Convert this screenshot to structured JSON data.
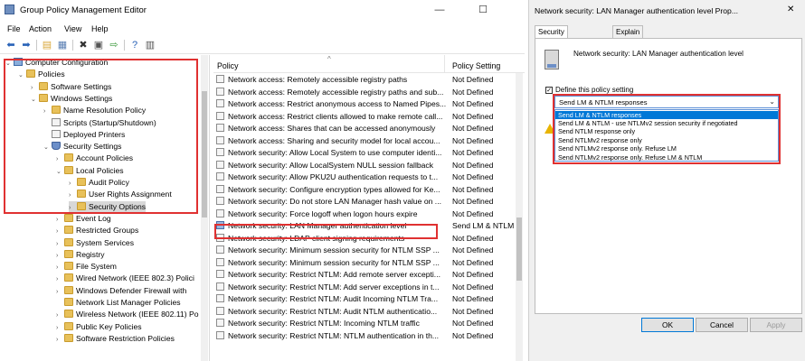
{
  "main_window": {
    "title": "Group Policy Management Editor",
    "controls": {
      "minimize": "—",
      "maximize": "☐"
    },
    "menu": [
      "File",
      "Action",
      "View",
      "Help"
    ]
  },
  "tree": {
    "items": [
      {
        "label": "Computer Configuration",
        "depth": 0,
        "expanded": true,
        "icon": "computer-icon"
      },
      {
        "label": "Policies",
        "depth": 1,
        "expanded": true,
        "icon": "folder-icon"
      },
      {
        "label": "Software Settings",
        "depth": 2,
        "expanded": false,
        "icon": "folder-icon"
      },
      {
        "label": "Windows Settings",
        "depth": 2,
        "expanded": true,
        "icon": "folder-icon"
      },
      {
        "label": "Name Resolution Policy",
        "depth": 3,
        "expanded": false,
        "icon": "folder-icon"
      },
      {
        "label": "Scripts (Startup/Shutdown)",
        "depth": 3,
        "expanded": null,
        "icon": "script-icon"
      },
      {
        "label": "Deployed Printers",
        "depth": 3,
        "expanded": null,
        "icon": "printer-icon"
      },
      {
        "label": "Security Settings",
        "depth": 3,
        "expanded": true,
        "icon": "shield-icon"
      },
      {
        "label": "Account Policies",
        "depth": 4,
        "expanded": false,
        "icon": "folder-icon"
      },
      {
        "label": "Local Policies",
        "depth": 4,
        "expanded": true,
        "icon": "folder-icon"
      },
      {
        "label": "Audit Policy",
        "depth": 5,
        "expanded": false,
        "icon": "folder-icon"
      },
      {
        "label": "User Rights Assignment",
        "depth": 5,
        "expanded": false,
        "icon": "folder-icon"
      },
      {
        "label": "Security Options",
        "depth": 5,
        "expanded": false,
        "icon": "folder-icon",
        "selected": true
      },
      {
        "label": "Event Log",
        "depth": 4,
        "expanded": false,
        "icon": "folder-icon"
      },
      {
        "label": "Restricted Groups",
        "depth": 4,
        "expanded": false,
        "icon": "folder-icon"
      },
      {
        "label": "System Services",
        "depth": 4,
        "expanded": false,
        "icon": "folder-icon"
      },
      {
        "label": "Registry",
        "depth": 4,
        "expanded": false,
        "icon": "folder-icon"
      },
      {
        "label": "File System",
        "depth": 4,
        "expanded": false,
        "icon": "folder-icon"
      },
      {
        "label": "Wired Network (IEEE 802.3) Polici",
        "depth": 4,
        "expanded": false,
        "icon": "folder-icon"
      },
      {
        "label": "Windows Defender Firewall with",
        "depth": 4,
        "expanded": false,
        "icon": "folder-icon"
      },
      {
        "label": "Network List Manager Policies",
        "depth": 4,
        "expanded": null,
        "icon": "folder-icon"
      },
      {
        "label": "Wireless Network (IEEE 802.11) Po",
        "depth": 4,
        "expanded": false,
        "icon": "folder-icon"
      },
      {
        "label": "Public Key Policies",
        "depth": 4,
        "expanded": false,
        "icon": "folder-icon"
      },
      {
        "label": "Software Restriction Policies",
        "depth": 4,
        "expanded": false,
        "icon": "folder-icon"
      }
    ]
  },
  "list": {
    "columns": [
      "Policy",
      "Policy Setting"
    ],
    "rows": [
      {
        "policy": "Network access: Remotely accessible registry paths",
        "setting": "Not Defined"
      },
      {
        "policy": "Network access: Remotely accessible registry paths and sub...",
        "setting": "Not Defined"
      },
      {
        "policy": "Network access: Restrict anonymous access to Named Pipes...",
        "setting": "Not Defined"
      },
      {
        "policy": "Network access: Restrict clients allowed to make remote call...",
        "setting": "Not Defined"
      },
      {
        "policy": "Network access: Shares that can be accessed anonymously",
        "setting": "Not Defined"
      },
      {
        "policy": "Network access: Sharing and security model for local accou...",
        "setting": "Not Defined"
      },
      {
        "policy": "Network security: Allow Local System to use computer identi...",
        "setting": "Not Defined"
      },
      {
        "policy": "Network security: Allow LocalSystem NULL session fallback",
        "setting": "Not Defined"
      },
      {
        "policy": "Network security: Allow PKU2U authentication requests to t...",
        "setting": "Not Defined"
      },
      {
        "policy": "Network security: Configure encryption types allowed for Ke...",
        "setting": "Not Defined"
      },
      {
        "policy": "Network security: Do not store LAN Manager hash value on ...",
        "setting": "Not Defined"
      },
      {
        "policy": "Network security: Force logoff when logon hours expire",
        "setting": "Not Defined"
      },
      {
        "policy": "Network security: LAN Manager authentication level",
        "setting": "Send LM & NTLM",
        "highlighted": true
      },
      {
        "policy": "Network security: LDAP client signing requirements",
        "setting": "Not Defined"
      },
      {
        "policy": "Network security: Minimum session security for NTLM SSP ...",
        "setting": "Not Defined"
      },
      {
        "policy": "Network security: Minimum session security for NTLM SSP ...",
        "setting": "Not Defined"
      },
      {
        "policy": "Network security: Restrict NTLM: Add remote server excepti...",
        "setting": "Not Defined"
      },
      {
        "policy": "Network security: Restrict NTLM: Add server exceptions in t...",
        "setting": "Not Defined"
      },
      {
        "policy": "Network security: Restrict NTLM: Audit Incoming NTLM Tra...",
        "setting": "Not Defined"
      },
      {
        "policy": "Network security: Restrict NTLM: Audit NTLM authenticatio...",
        "setting": "Not Defined"
      },
      {
        "policy": "Network security: Restrict NTLM: Incoming NTLM traffic",
        "setting": "Not Defined"
      },
      {
        "policy": "Network security: Restrict NTLM: NTLM authentication in th...",
        "setting": "Not Defined"
      }
    ]
  },
  "dialog": {
    "title": "Network security: LAN Manager authentication level Prop...",
    "close": "✕",
    "tabs": [
      "Security Policy Setting",
      "Explain"
    ],
    "policy_name": "Network security: LAN Manager authentication level",
    "define_label": "Define this policy setting",
    "define_checked": "✓",
    "selected_value": "Send LM & NTLM responses",
    "options": [
      "Send LM & NTLM responses",
      "Send LM & NTLM - use NTLMv2 session security if negotiated",
      "Send NTLM response only",
      "Send NTLMv2 response only",
      "Send NTLMv2 response only. Refuse LM",
      "Send NTLMv2 response only. Refuse LM & NTLM"
    ],
    "buttons": {
      "ok": "OK",
      "cancel": "Cancel",
      "apply": "Apply"
    }
  },
  "colors": {
    "highlight_box": "#e03131",
    "selection": "#0078d7"
  }
}
